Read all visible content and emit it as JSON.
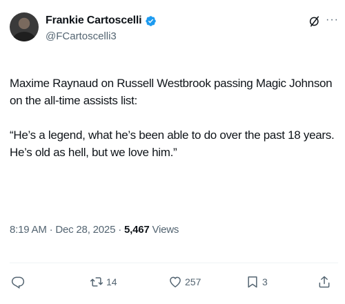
{
  "author": {
    "display_name": "Frankie Cartoscelli",
    "handle": "@FCartoscelli3",
    "verified": true,
    "verified_color": "#1d9bf0"
  },
  "tweet": {
    "paragraphs": [
      "Maxime Raynaud on Russell Westbrook passing Magic Johnson on the all-time assists list:",
      "“He’s a legend, what he’s been able to do over the past 18 years. He’s old as hell, but we love him.”"
    ]
  },
  "meta": {
    "time": "8:19 AM",
    "separator": "·",
    "date": "Dec 28, 2025",
    "views_count": "5,467",
    "views_label": "Views"
  },
  "actions": {
    "reply_count": "",
    "repost_count": "14",
    "like_count": "257",
    "bookmark_count": "3"
  },
  "icons": [
    "avatar",
    "verified-badge-icon",
    "grok-icon",
    "more-icon",
    "reply-icon",
    "repost-icon",
    "like-icon",
    "bookmark-icon",
    "share-icon"
  ]
}
